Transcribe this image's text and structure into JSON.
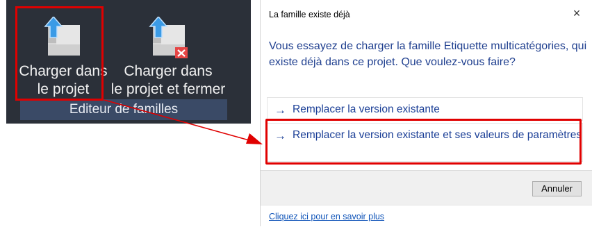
{
  "ribbon": {
    "buttons": [
      {
        "label_line1": "Charger dans",
        "label_line2": "le projet",
        "icon": "load-into-project-icon"
      },
      {
        "label_line1": "Charger dans",
        "label_line2": "le projet et fermer",
        "icon": "load-into-project-and-close-icon"
      }
    ],
    "panel_title": "Editeur de familles"
  },
  "dialog": {
    "title": "La famille existe déjà",
    "close_glyph": "×",
    "message": "Vous essayez de charger la famille Etiquette multicatégories, qui existe déjà dans ce projet. Que voulez-vous faire?",
    "options": [
      {
        "arrow": "→",
        "label": "Remplacer la version existante"
      },
      {
        "arrow": "→",
        "label": "Remplacer la version existante et ses valeurs de paramètres"
      }
    ],
    "cancel_label": "Annuler",
    "help_link": "Cliquez ici pour en savoir plus"
  },
  "colors": {
    "ribbon_bg": "#2b3039",
    "ribbon_footer_bg": "#3a4a66",
    "highlight": "#e00000",
    "dialog_link": "#1a3e96"
  }
}
